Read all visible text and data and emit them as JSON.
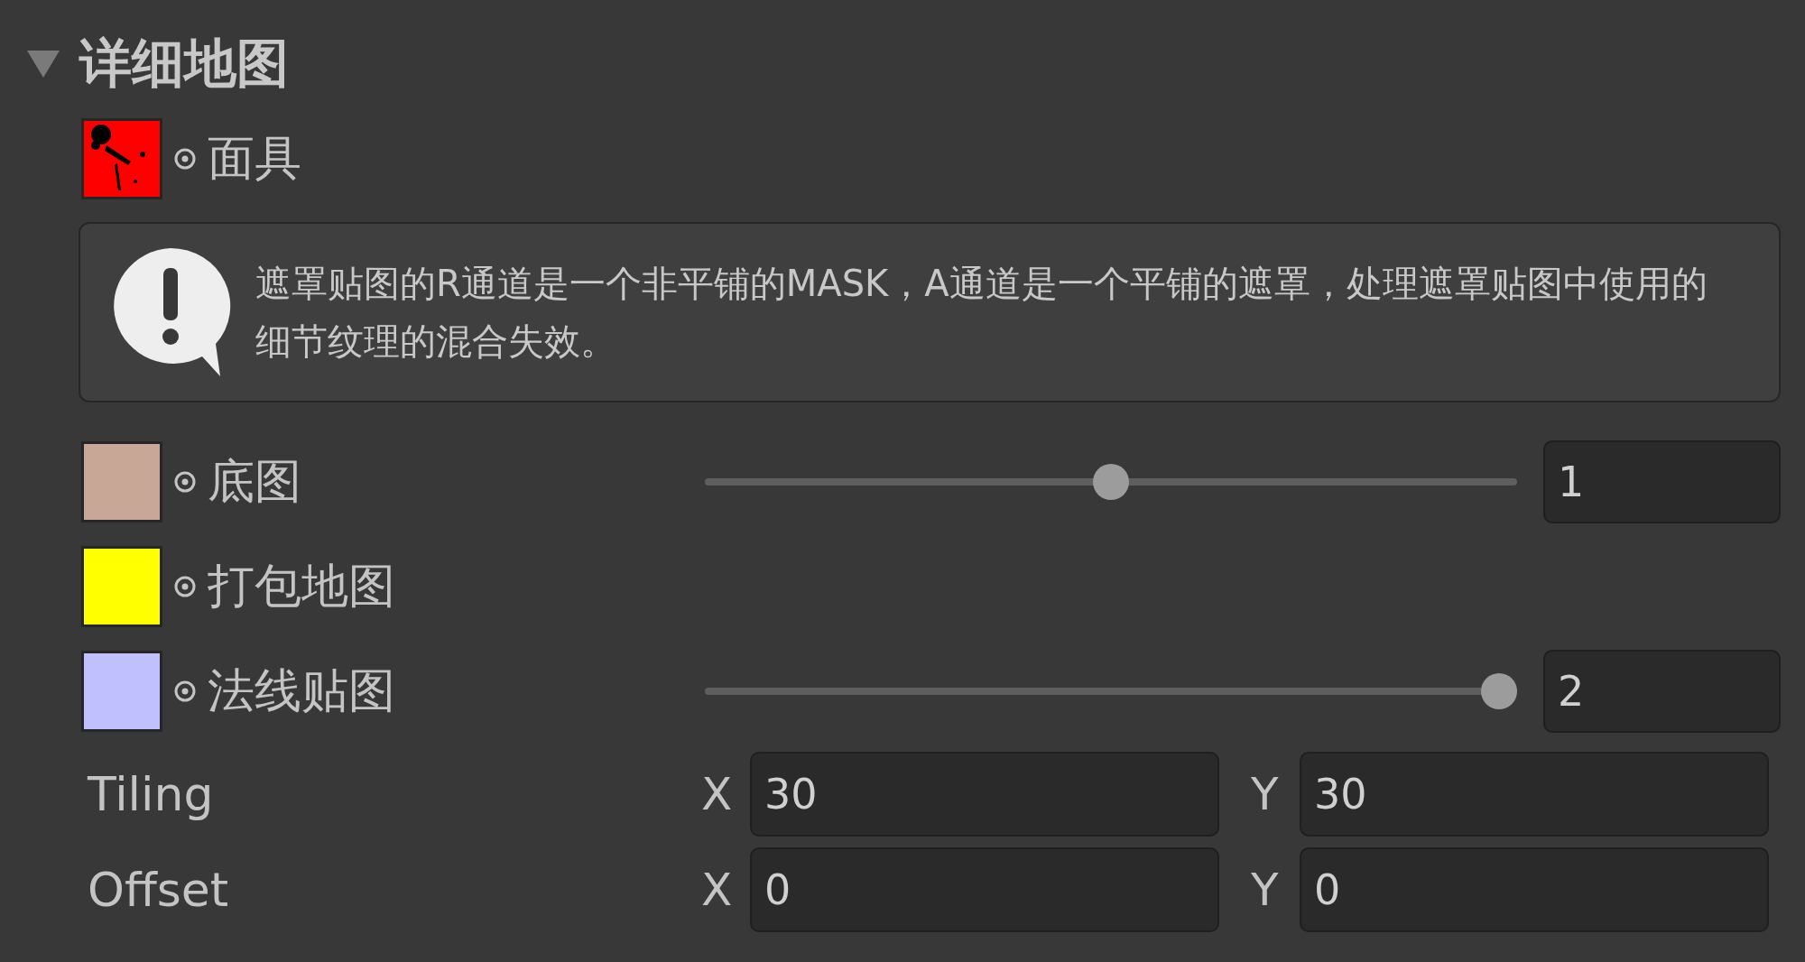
{
  "section": {
    "title": "详细地图",
    "expanded": true
  },
  "properties": [
    {
      "kind": "texture",
      "label": "面具",
      "color": "#ff0000",
      "speckled": true
    },
    {
      "kind": "help",
      "text": "遮罩贴图的R通道是一个非平铺的MASK，A通道是一个平铺的遮罩，处理遮罩贴图中使用的细节纹理的混合失效。"
    },
    {
      "kind": "texture",
      "label": "底图",
      "color": "#c8a796",
      "speckled": false,
      "slider": {
        "level": 0.5,
        "value": "1"
      }
    },
    {
      "kind": "texture",
      "label": "打包地图",
      "color": "#ffff00",
      "speckled": false
    },
    {
      "kind": "texture",
      "label": "法线贴图",
      "color": "#c0c0ff",
      "speckled": false,
      "slider": {
        "level": 1,
        "value": "2"
      }
    },
    {
      "kind": "vector",
      "label": "Tiling",
      "fields": [
        {
          "axis": "X",
          "value": "30"
        },
        {
          "axis": "Y",
          "value": "30"
        }
      ]
    },
    {
      "kind": "vector",
      "label": "Offset",
      "fields": [
        {
          "axis": "X",
          "value": "0"
        },
        {
          "axis": "Y",
          "value": "0"
        }
      ]
    }
  ]
}
